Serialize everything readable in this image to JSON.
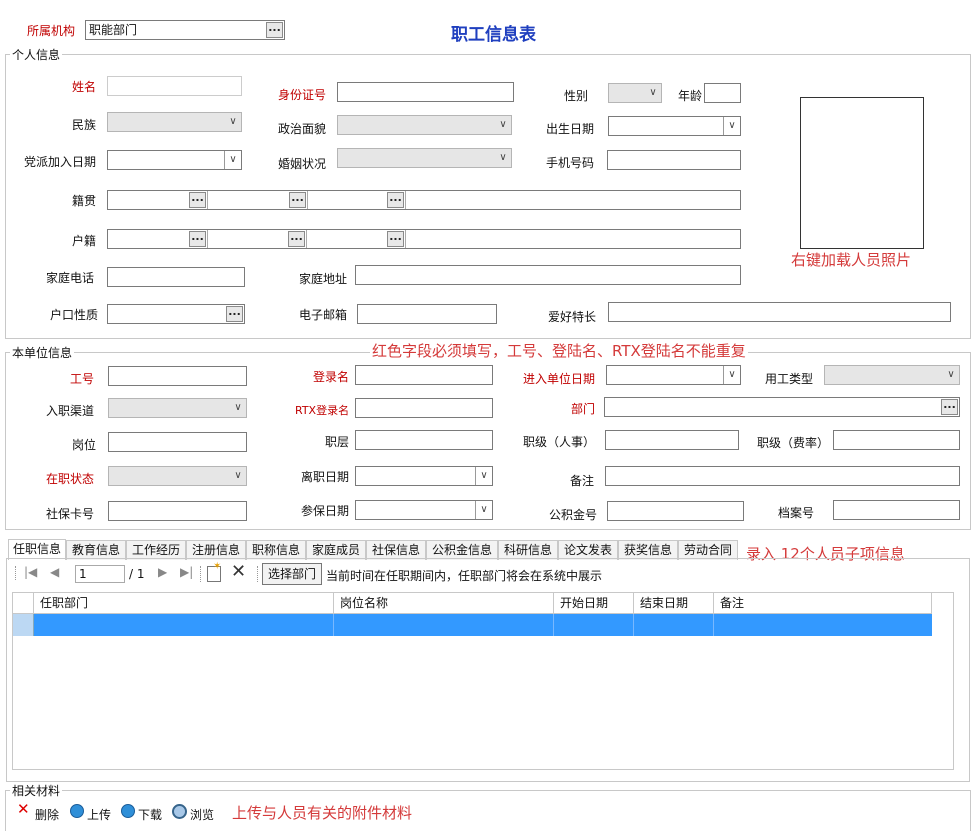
{
  "top": {
    "org_label": "所属机构",
    "org_value": "职能部门",
    "title": "职工信息表"
  },
  "personal": {
    "group_title": "个人信息",
    "name_label": "姓名",
    "idcard_label": "身份证号",
    "gender_label": "性别",
    "age_label": "年龄",
    "ethnicity_label": "民族",
    "political_label": "政治面貌",
    "birthdate_label": "出生日期",
    "party_date_label": "党派加入日期",
    "marital_label": "婚姻状况",
    "phone_label": "手机号码",
    "native_label": "籍贯",
    "household_label": "户籍",
    "home_phone_label": "家庭电话",
    "home_addr_label": "家庭地址",
    "hukou_type_label": "户口性质",
    "email_label": "电子邮箱",
    "hobby_label": "爱好特长",
    "photo_note": "右键加载人员照片"
  },
  "unit": {
    "group_title": "本单位信息",
    "required_note": "红色字段必须填写，工号、登陆名、RTX登陆名不能重复",
    "empno_label": "工号",
    "login_label": "登录名",
    "entry_date_label": "进入单位日期",
    "emp_type_label": "用工类型",
    "channel_label": "入职渠道",
    "rtx_label": "RTX登录名",
    "dept_label": "部门",
    "post_label": "岗位",
    "level_label": "职层",
    "grade_hr_label": "职级（人事）",
    "grade_fee_label": "职级（费率）",
    "status_label": "在职状态",
    "leave_date_label": "离职日期",
    "remark_label": "备注",
    "social_card_label": "社保卡号",
    "insure_date_label": "参保日期",
    "fund_no_label": "公积金号",
    "archive_no_label": "档案号"
  },
  "tabs": [
    "任职信息",
    "教育信息",
    "工作经历",
    "注册信息",
    "职称信息",
    "家庭成员",
    "社保信息",
    "公积金信息",
    "科研信息",
    "论文发表",
    "获奖信息",
    "劳动合同"
  ],
  "tabs_note": "录入 12个人员子项信息",
  "pager": {
    "current_page": "1",
    "total": "/ 1",
    "select_dept_label": "选择部门",
    "hint": "当前时间在任职期间内，任职部门将会在系统中展示"
  },
  "grid": {
    "columns": [
      "任职部门",
      "岗位名称",
      "开始日期",
      "结束日期",
      "备注"
    ]
  },
  "attachments": {
    "group_title": "相关材料",
    "delete_label": "删除",
    "upload_label": "上传",
    "download_label": "下载",
    "browse_label": "浏览",
    "note": "上传与人员有关的附件材料"
  },
  "colors": {
    "required": "#c00000",
    "title": "#1f3fbf",
    "note": "#d43a3a",
    "selected_row": "#3399ff"
  }
}
